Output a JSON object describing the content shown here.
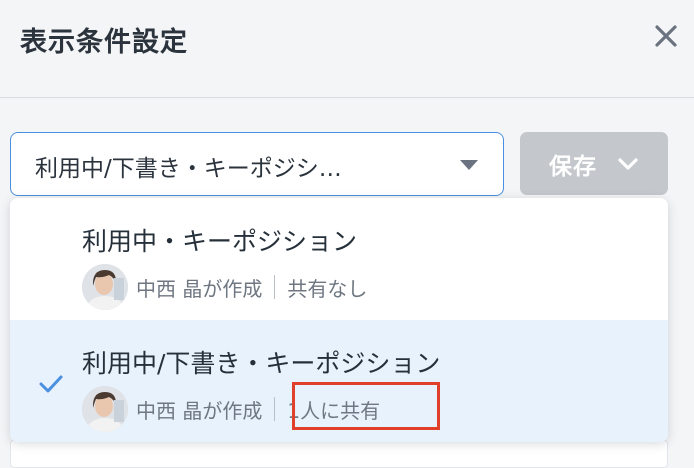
{
  "dialog": {
    "title": "表示条件設定",
    "close_icon": "close-icon"
  },
  "toolbar": {
    "selected_value": "利用中/下書き・キーポジシ…",
    "save_label": "保存",
    "save_menu_icon": "chevron-down-icon"
  },
  "options": [
    {
      "name": "利用中・キーポジション",
      "creator": "中西 晶が作成",
      "share": "共有なし",
      "selected": false
    },
    {
      "name": "利用中/下書き・キーポジション",
      "creator": "中西 晶が作成",
      "share": "1人に共有",
      "selected": true
    }
  ],
  "colors": {
    "accent": "#4a8fe0",
    "selected_row_bg": "#e8f2fd",
    "highlight": "#e0402a",
    "save_disabled_bg": "#c4c8cd"
  }
}
